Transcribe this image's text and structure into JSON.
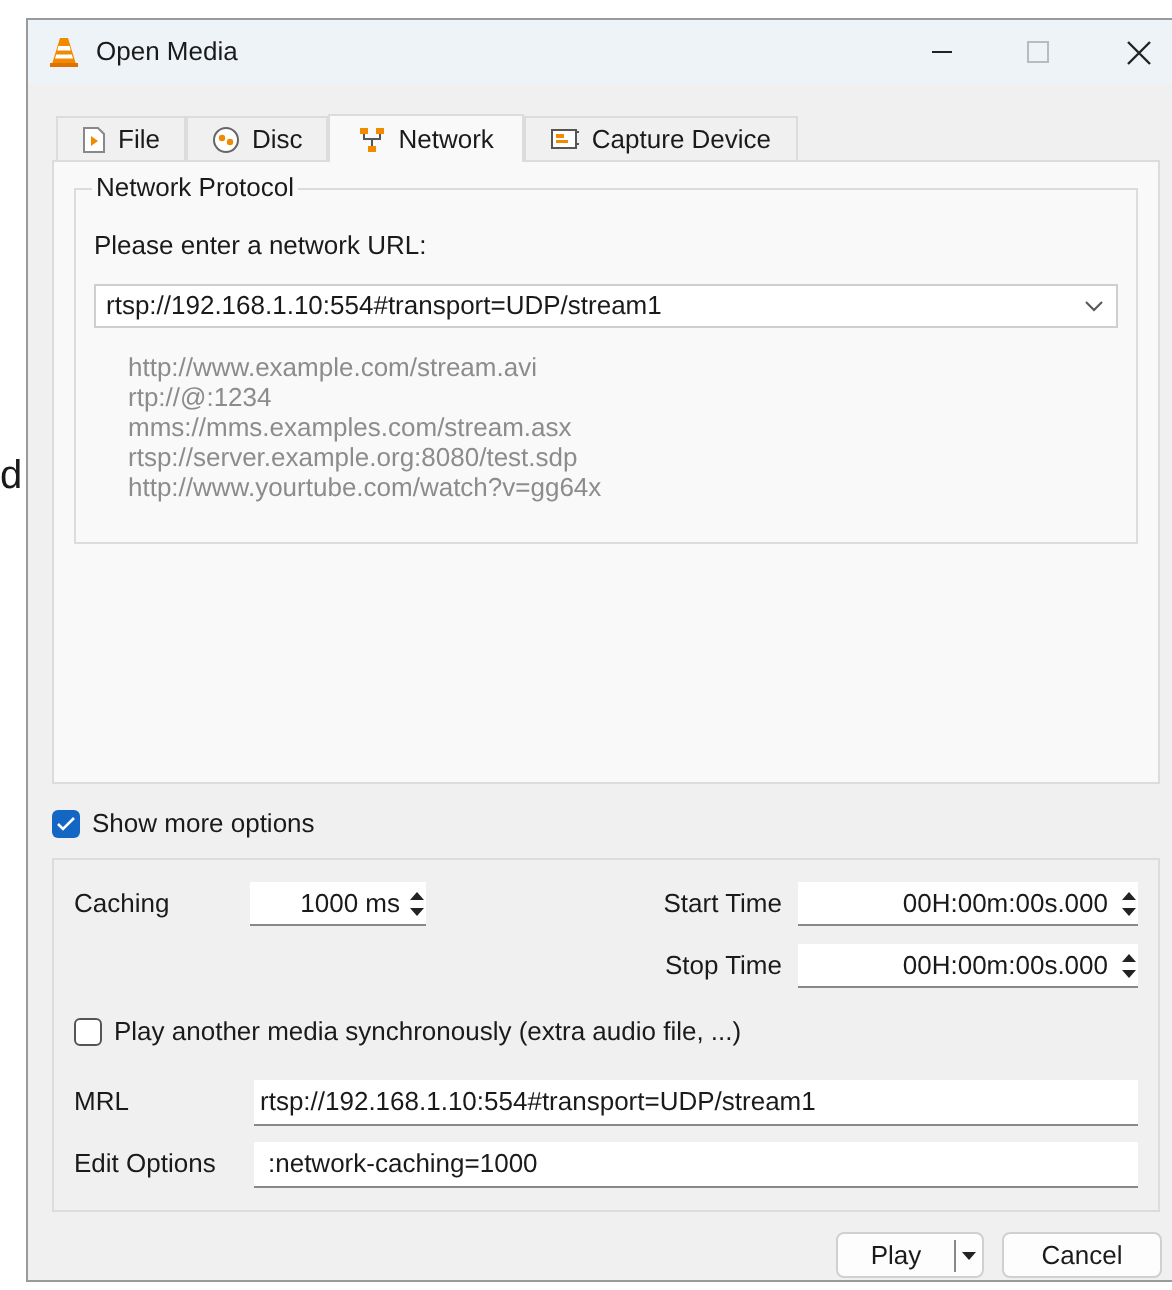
{
  "background_text": "d",
  "window": {
    "title": "Open Media"
  },
  "tabs": [
    {
      "label": "File",
      "selected": false
    },
    {
      "label": "Disc",
      "selected": false
    },
    {
      "label": "Network",
      "selected": true
    },
    {
      "label": "Capture Device",
      "selected": false
    }
  ],
  "network_protocol": {
    "title": "Network Protocol",
    "prompt": "Please enter a network URL:",
    "url": "rtsp://192.168.1.10:554#transport=UDP/stream1",
    "examples": [
      "http://www.example.com/stream.avi",
      "rtp://@:1234",
      "mms://mms.examples.com/stream.asx",
      "rtsp://server.example.org:8080/test.sdp",
      "http://www.yourtube.com/watch?v=gg64x"
    ]
  },
  "show_more_options": {
    "label": "Show more options",
    "checked": true
  },
  "options": {
    "caching": {
      "label": "Caching",
      "value": "1000 ms"
    },
    "start_time": {
      "label": "Start Time",
      "value": "00H:00m:00s.000"
    },
    "stop_time": {
      "label": "Stop Time",
      "value": "00H:00m:00s.000"
    },
    "play_another": {
      "label": "Play another media synchronously (extra audio file, ...)",
      "checked": false
    },
    "mrl": {
      "label": "MRL",
      "value": "rtsp://192.168.1.10:554#transport=UDP/stream1"
    },
    "edit_options": {
      "label": "Edit Options",
      "value": ":network-caching=1000"
    }
  },
  "buttons": {
    "play": "Play",
    "cancel": "Cancel"
  }
}
